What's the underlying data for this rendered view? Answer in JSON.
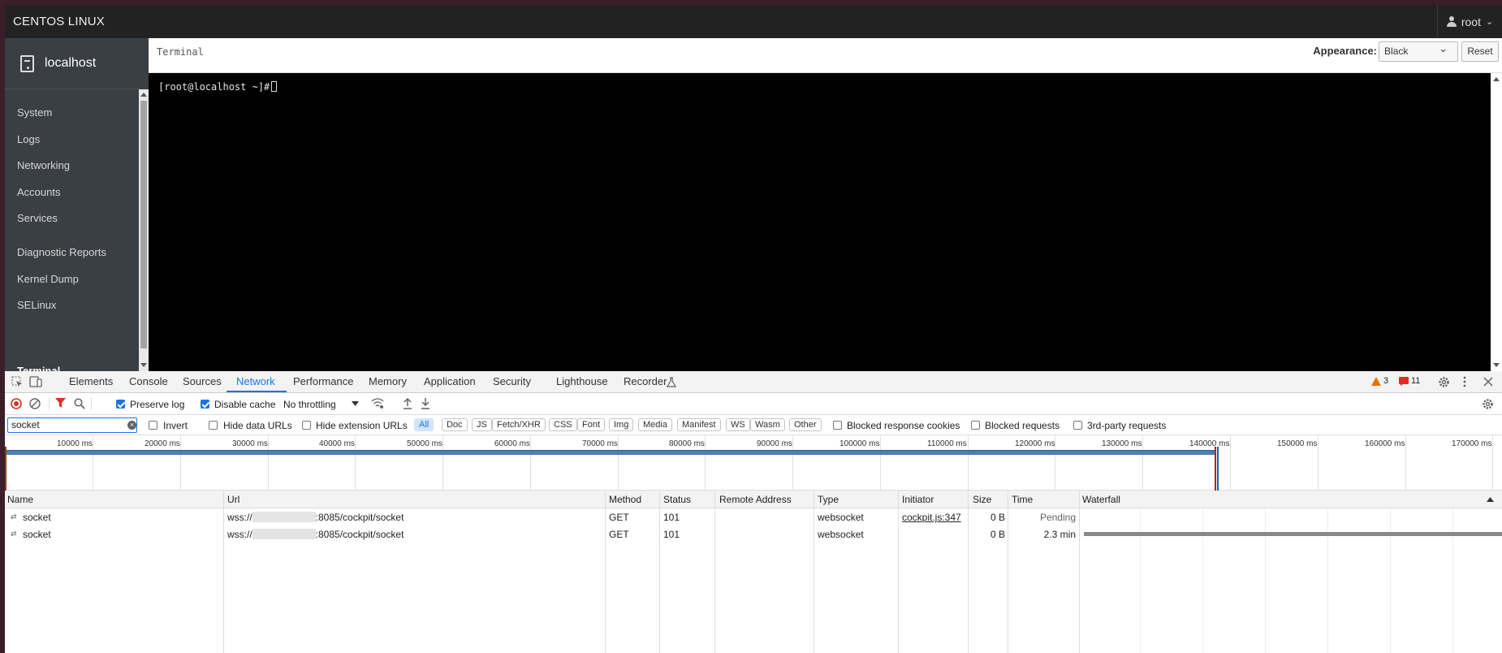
{
  "topbar": {
    "brand": "CENTOS LINUX",
    "user": "root"
  },
  "sidebar": {
    "host": "localhost",
    "items": [
      {
        "label": "System"
      },
      {
        "label": "Logs"
      },
      {
        "label": "Networking"
      },
      {
        "label": "Accounts"
      },
      {
        "label": "Services"
      },
      {
        "label": "Diagnostic Reports"
      },
      {
        "label": "Kernel Dump"
      },
      {
        "label": "SELinux"
      },
      {
        "label": "Terminal"
      }
    ]
  },
  "terminal": {
    "title": "Terminal",
    "appearance_label": "Appearance:",
    "appearance_value": "Black",
    "reset_label": "Reset",
    "prompt": "[root@localhost ~]#"
  },
  "devtools": {
    "tabs": [
      "Elements",
      "Console",
      "Sources",
      "Network",
      "Performance",
      "Memory",
      "Application",
      "Security",
      "Lighthouse",
      "Recorder"
    ],
    "active_tab": "Network",
    "warnings": "3",
    "errors": "11",
    "toolbar": {
      "preserve_log": "Preserve log",
      "disable_cache": "Disable cache",
      "throttling": "No throttling"
    },
    "filter": {
      "value": "socket",
      "invert": "Invert",
      "hide_data_urls": "Hide data URLs",
      "hide_extension_urls": "Hide extension URLs",
      "types": [
        "All",
        "Doc",
        "JS",
        "Fetch/XHR",
        "CSS",
        "Font",
        "Img",
        "Media",
        "Manifest",
        "WS",
        "Wasm",
        "Other"
      ],
      "blocked_cookies": "Blocked response cookies",
      "blocked_requests": "Blocked requests",
      "third_party": "3rd-party requests"
    },
    "overview_ticks": [
      "10000 ms",
      "20000 ms",
      "30000 ms",
      "40000 ms",
      "50000 ms",
      "60000 ms",
      "70000 ms",
      "80000 ms",
      "90000 ms",
      "100000 ms",
      "110000 ms",
      "120000 ms",
      "130000 ms",
      "140000 ms",
      "150000 ms",
      "160000 ms",
      "170000 ms"
    ],
    "columns": [
      "Name",
      "Url",
      "Method",
      "Status",
      "Remote Address",
      "Type",
      "Initiator",
      "Size",
      "Time",
      "Waterfall"
    ],
    "rows": [
      {
        "name": "socket",
        "url_prefix": "wss://",
        "url_suffix": ":8085/cockpit/socket",
        "method": "GET",
        "status": "101",
        "remote": "",
        "type": "websocket",
        "initiator": "cockpit.js:347",
        "size": "0 B",
        "time": "Pending"
      },
      {
        "name": "socket",
        "url_prefix": "wss://",
        "url_suffix": ":8085/cockpit/socket",
        "method": "GET",
        "status": "101",
        "remote": "",
        "type": "websocket",
        "initiator": "",
        "size": "0 B",
        "time": "2.3 min"
      }
    ]
  }
}
